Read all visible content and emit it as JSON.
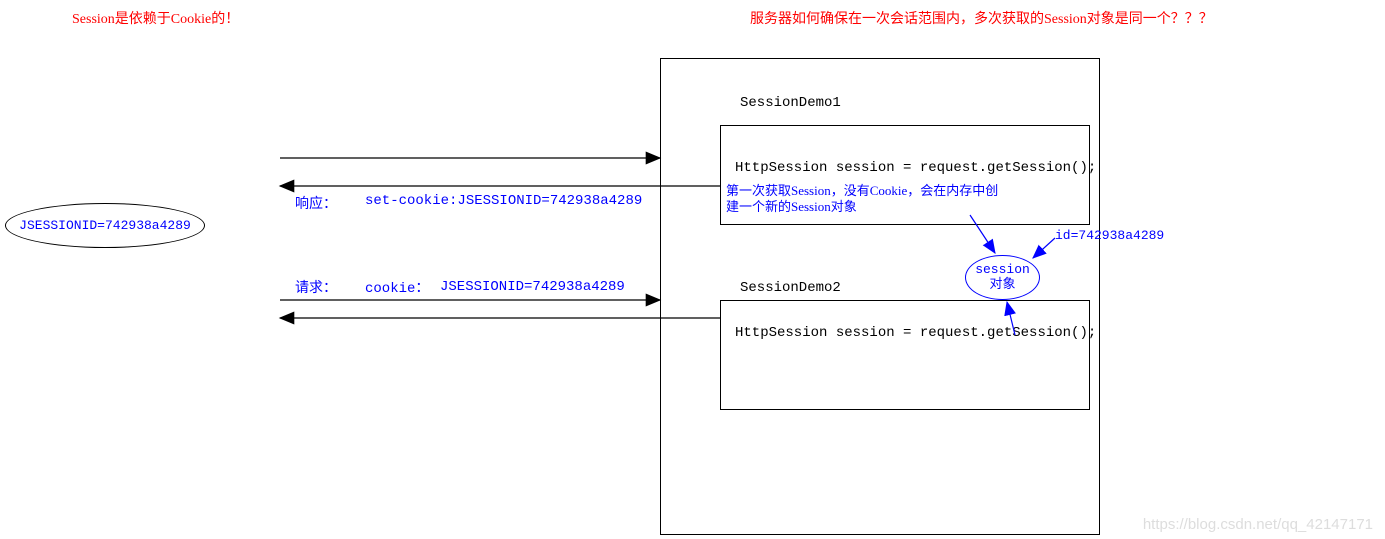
{
  "headings": {
    "left_red": "Session是依赖于Cookie的！",
    "right_red": "服务器如何确保在一次会话范围内，多次获取的Session对象是同一个？？？"
  },
  "client": {
    "cookie_value": "JSESSIONID=742938a4289"
  },
  "server": {
    "demo1": {
      "title": "SessionDemo1",
      "code": "HttpSession session = request.getSession();",
      "note": "第一次获取Session，没有Cookie，会在内存中创建一个新的Session对象"
    },
    "demo2": {
      "title": "SessionDemo2",
      "code": "HttpSession session = request.getSession();"
    },
    "session_object": {
      "line1": "session",
      "line2": "对象",
      "id_label": "id=742938a4289"
    }
  },
  "arrows": {
    "response_label": "响应：",
    "response_header": "set-cookie:JSESSIONID=742938a4289",
    "request_label": "请求：",
    "request_cookie_label": "cookie：",
    "request_cookie_value": "JSESSIONID=742938a4289"
  },
  "watermark": "https://blog.csdn.net/qq_42147171"
}
